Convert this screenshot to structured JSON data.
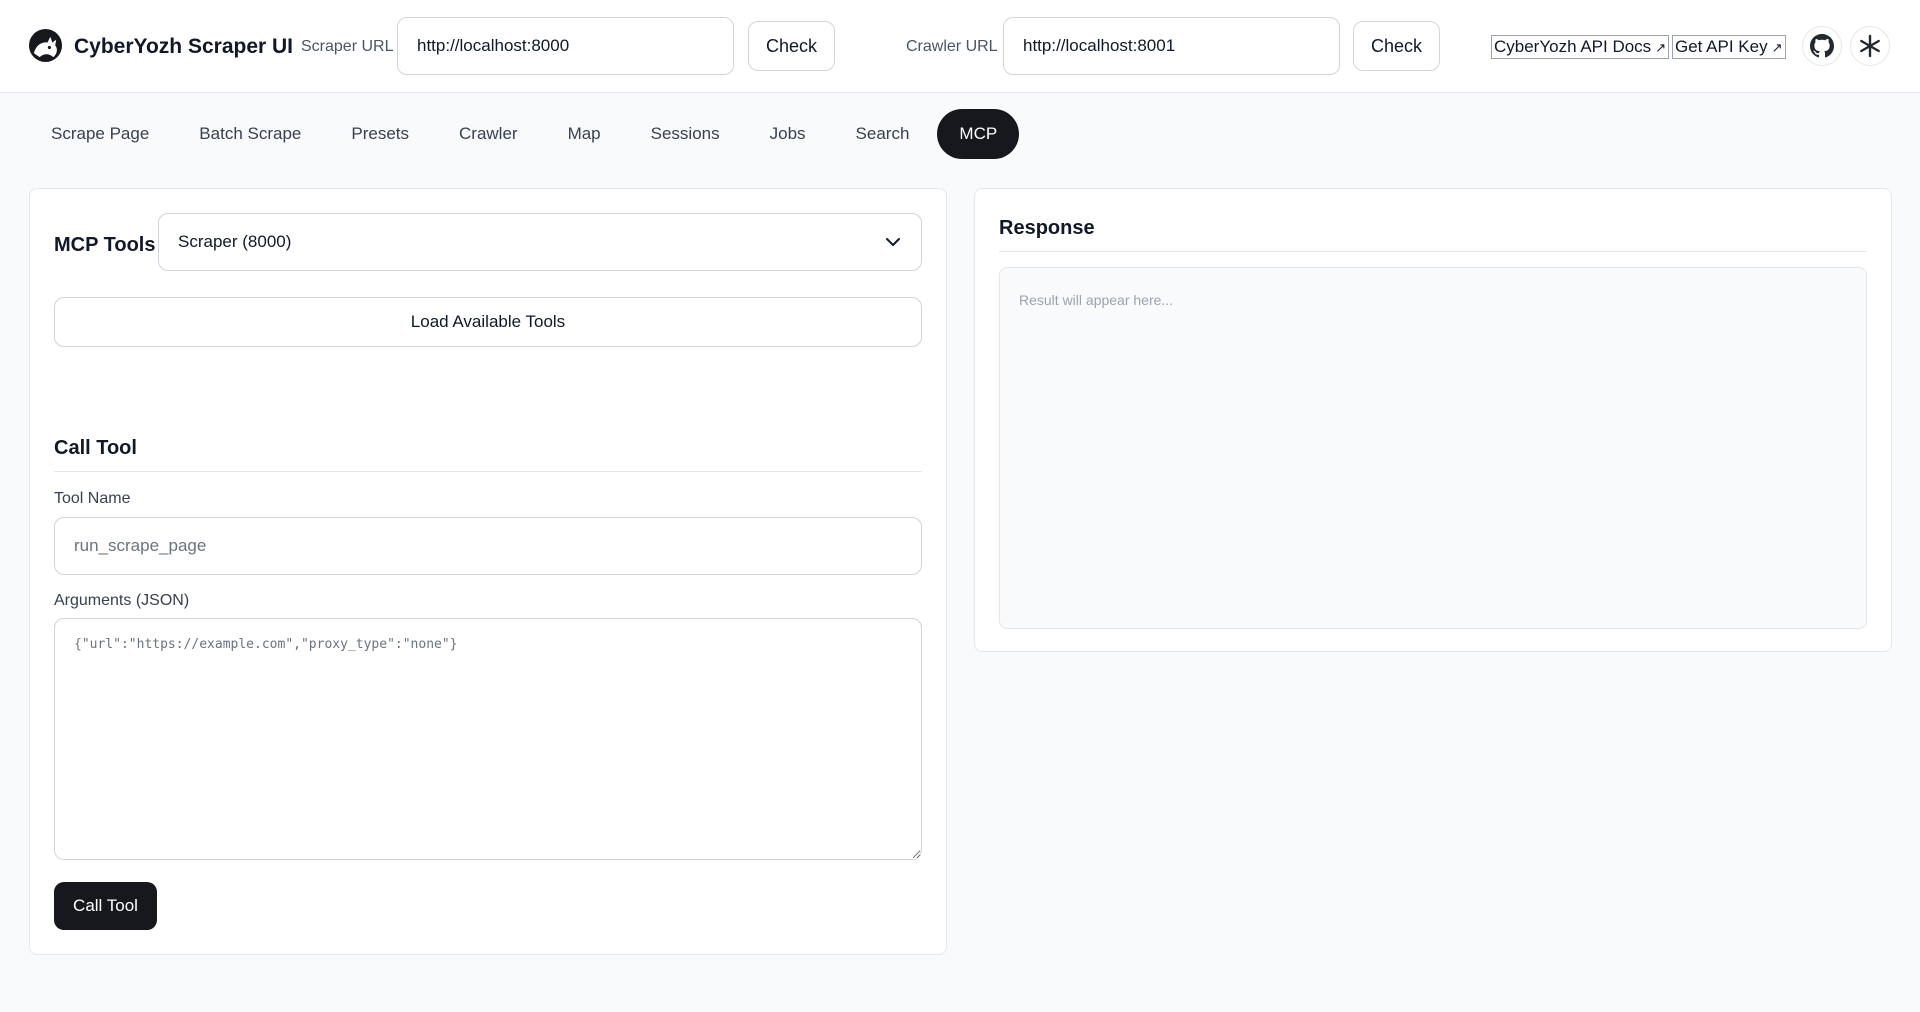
{
  "header": {
    "app_title": "CyberYozh Scraper UI",
    "scraper_label": "Scraper URL",
    "scraper_url": "http://localhost:8000",
    "crawler_label": "Crawler URL",
    "crawler_url": "http://localhost:8001",
    "check_label": "Check",
    "api_docs_label": "CyberYozh API Docs",
    "api_key_label": "Get API Key",
    "external_icon": "↗",
    "icons": [
      "github-icon",
      "asterisk-icon"
    ]
  },
  "tabs": [
    {
      "label": "Scrape Page",
      "active": false
    },
    {
      "label": "Batch Scrape",
      "active": false
    },
    {
      "label": "Presets",
      "active": false
    },
    {
      "label": "Crawler",
      "active": false
    },
    {
      "label": "Map",
      "active": false
    },
    {
      "label": "Sessions",
      "active": false
    },
    {
      "label": "Jobs",
      "active": false
    },
    {
      "label": "Search",
      "active": false
    },
    {
      "label": "MCP",
      "active": true
    }
  ],
  "mcp": {
    "title": "MCP Tools",
    "selected_server": "Scraper (8000)",
    "load_button": "Load Available Tools",
    "call_section_title": "Call Tool",
    "tool_name_label": "Tool Name",
    "tool_name_placeholder": "run_scrape_page",
    "args_label": "Arguments (JSON)",
    "args_placeholder": "{\"url\":\"https://example.com\",\"proxy_type\":\"none\"}",
    "call_button": "Call Tool"
  },
  "response": {
    "title": "Response",
    "placeholder": "Result will appear here..."
  },
  "colors": {
    "accent": "#16181d",
    "background": "#f9fafb",
    "border": "#d1d5db"
  }
}
